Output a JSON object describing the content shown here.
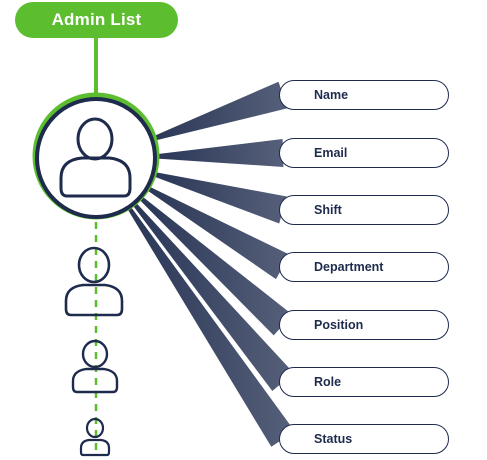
{
  "title": "Admin List",
  "fields": [
    {
      "label": "Name"
    },
    {
      "label": "Email"
    },
    {
      "label": "Shift"
    },
    {
      "label": "Department"
    },
    {
      "label": "Position"
    },
    {
      "label": "Role"
    },
    {
      "label": "Status"
    }
  ],
  "colors": {
    "accent_green": "#5cbd2f",
    "navy": "#1e2b4d",
    "white": "#ffffff"
  },
  "icons": [
    "admin-user-icon",
    "user-icon"
  ]
}
